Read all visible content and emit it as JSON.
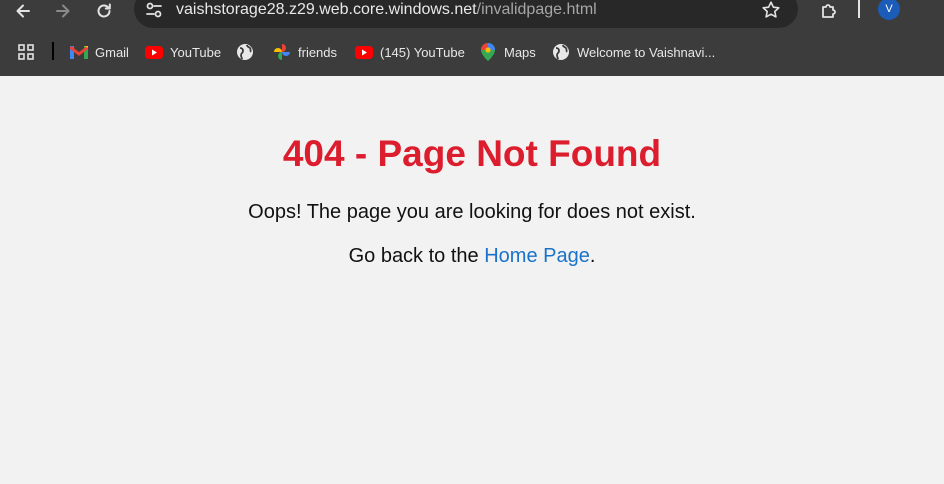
{
  "browser": {
    "url_host": "vaishstorage28.z29.web.core.windows.net",
    "url_path": "/invalidpage.html",
    "profile_initial": "V"
  },
  "bookmarks": [
    {
      "label": "Gmail",
      "icon": "gmail-icon"
    },
    {
      "label": "YouTube",
      "icon": "youtube-icon"
    },
    {
      "label": "",
      "icon": "globe-icon"
    },
    {
      "label": "friends",
      "icon": "photos-pinwheel-icon"
    },
    {
      "label": "(145) YouTube",
      "icon": "youtube-icon"
    },
    {
      "label": "Maps",
      "icon": "maps-pin-icon"
    },
    {
      "label": "Welcome to Vaishnavi...",
      "icon": "globe-icon"
    }
  ],
  "page": {
    "title": "404 - Page Not Found",
    "message": "Oops! The page you are looking for does not exist.",
    "back_prefix": "Go back to the ",
    "back_link": "Home Page",
    "back_suffix": "."
  },
  "colors": {
    "title": "#dc1d2d",
    "link": "#1a73c8",
    "page_background": "#f2f2f2",
    "chrome_background": "#3c3c3c",
    "youtube": "#ff0000",
    "avatar": "#1a5cb8"
  }
}
